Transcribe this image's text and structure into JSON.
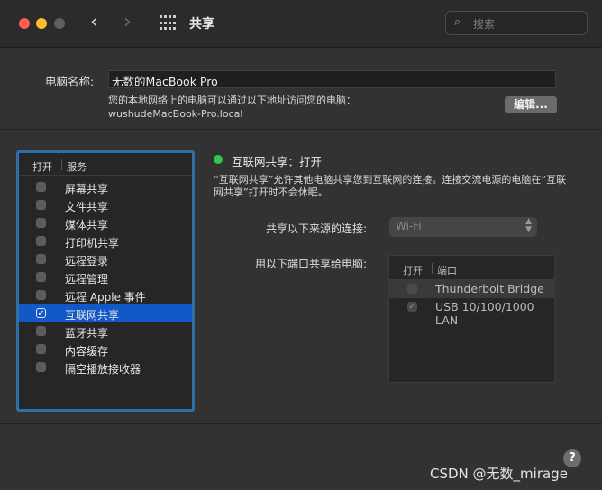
{
  "window": {
    "title": "共享",
    "back_icon": "chevron-left-icon",
    "forward_icon": "chevron-right-icon",
    "grid_icon": "grid-icon",
    "search_placeholder": "搜索"
  },
  "computer_name": {
    "label": "电脑名称:",
    "value": "无数的MacBook Pro",
    "desc_line1": "您的本地网络上的电脑可以通过以下地址访问您的电脑：",
    "desc_line2": "wushudeMacBook-Pro.local",
    "edit_label": "编辑..."
  },
  "services": {
    "col_on": "打开",
    "col_service": "服务",
    "items": [
      {
        "label": "屏幕共享",
        "checked": false
      },
      {
        "label": "文件共享",
        "checked": false
      },
      {
        "label": "媒体共享",
        "checked": false
      },
      {
        "label": "打印机共享",
        "checked": false
      },
      {
        "label": "远程登录",
        "checked": false
      },
      {
        "label": "远程管理",
        "checked": false
      },
      {
        "label": "远程 Apple 事件",
        "checked": false
      },
      {
        "label": "互联网共享",
        "checked": true,
        "selected": true
      },
      {
        "label": "蓝牙共享",
        "checked": false
      },
      {
        "label": "内容缓存",
        "checked": false
      },
      {
        "label": "隔空播放接收器",
        "checked": false
      }
    ]
  },
  "detail": {
    "status": "互联网共享：打开",
    "status_color": "#33c748",
    "desc_line1": "“互联网共享”允许其他电脑共享您到互联网的连接。连接交流电源的电脑在“互联",
    "desc_line2": "网共享”打开时不会休眠。",
    "from_label": "共享以下来源的连接:",
    "from_value": "Wi-Fi",
    "to_label": "用以下端口共享给电脑:",
    "ports_col_on": "打开",
    "ports_col_port": "端口",
    "ports": [
      {
        "label": "Thunderbolt Bridge",
        "checked": false
      },
      {
        "label": "USB 10/100/1000 LAN",
        "checked": true
      }
    ]
  },
  "help_label": "?",
  "watermark": "CSDN @无数_mirage",
  "accent_color": "#1358c7"
}
